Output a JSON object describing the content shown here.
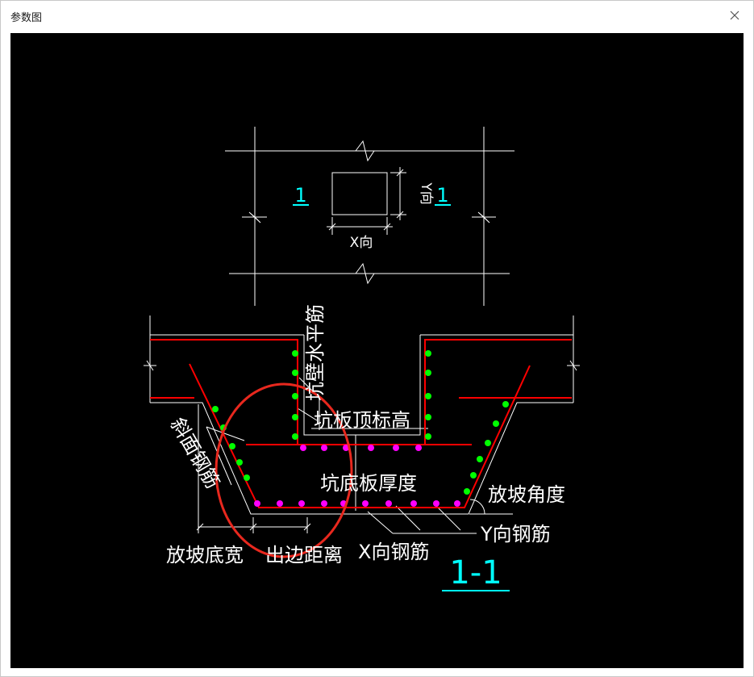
{
  "window": {
    "title": "参数图"
  },
  "icons": {
    "close": "close-icon"
  },
  "colors": {
    "background": "#000000",
    "line": "#ffffff",
    "rebar": "#ff0000",
    "green_dot": "#00ff00",
    "magenta_dot": "#ff00ff",
    "section_mark": "#00ffff",
    "highlight": "#e8281e"
  },
  "plan": {
    "section_mark_left": "1",
    "section_mark_right": "1",
    "x_dir": "X向",
    "y_dir": "Y向"
  },
  "section": {
    "wall_horizontal_rebar": "坑壁水平筋",
    "top_elevation": "坑板顶标高",
    "bottom_thickness": "坑底板厚度",
    "slope_angle": "放坡角度",
    "slope_rebar": "斜面钢筋",
    "slope_bottom_width": "放坡底宽",
    "edge_distance": "出边距离",
    "x_rebar": "X向钢筋",
    "y_rebar": "Y向钢筋",
    "section_title": "1-1"
  }
}
